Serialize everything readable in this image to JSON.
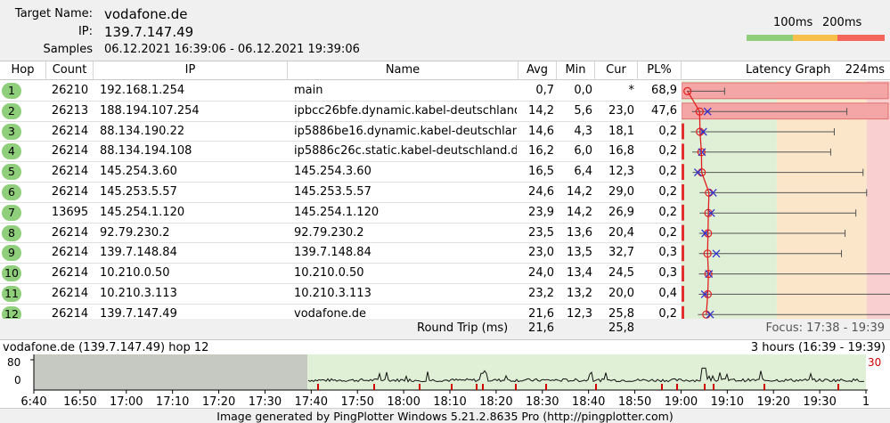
{
  "header": {
    "target_label": "Target Name:",
    "target_value": "vodafone.de",
    "ip_label": "IP:",
    "ip_value": "139.7.147.49",
    "samples_label": "Samples Timed:",
    "samples_value": "06.12.2021 16:39:06 - 06.12.2021 19:39:06"
  },
  "legend": {
    "label_100": "100ms",
    "label_200": "200ms",
    "colors": [
      "#8fce7a",
      "#f7c04a",
      "#f4665c"
    ]
  },
  "columns": {
    "hop": "Hop",
    "count": "Count",
    "ip": "IP",
    "name": "Name",
    "avg": "Avg",
    "min": "Min",
    "cur": "Cur",
    "pl": "PL%",
    "graph": "Latency Graph",
    "graph_max": "224ms"
  },
  "hops": [
    {
      "hop": "1",
      "count": "26210",
      "ip": "192.168.1.254",
      "name": "main",
      "avg": "0,7",
      "min": "0,0",
      "cur": "*",
      "pl": "68,9"
    },
    {
      "hop": "2",
      "count": "26213",
      "ip": "188.194.107.254",
      "name": "ipbcc26bfe.dynamic.kabel-deutschland.",
      "avg": "14,2",
      "min": "5,6",
      "cur": "23,0",
      "pl": "47,6"
    },
    {
      "hop": "3",
      "count": "26214",
      "ip": "88.134.190.22",
      "name": "ip5886be16.dynamic.kabel-deutschland",
      "avg": "14,6",
      "min": "4,3",
      "cur": "18,1",
      "pl": "0,2"
    },
    {
      "hop": "4",
      "count": "26214",
      "ip": "88.134.194.108",
      "name": "ip5886c26c.static.kabel-deutschland.de",
      "avg": "16,2",
      "min": "6,0",
      "cur": "16,8",
      "pl": "0,2"
    },
    {
      "hop": "5",
      "count": "26214",
      "ip": "145.254.3.60",
      "name": "145.254.3.60",
      "avg": "16,5",
      "min": "6,4",
      "cur": "12,3",
      "pl": "0,2"
    },
    {
      "hop": "6",
      "count": "26214",
      "ip": "145.253.5.57",
      "name": "145.253.5.57",
      "avg": "24,6",
      "min": "14,2",
      "cur": "29,0",
      "pl": "0,2"
    },
    {
      "hop": "7",
      "count": "13695",
      "ip": "145.254.1.120",
      "name": "145.254.1.120",
      "avg": "23,9",
      "min": "14,2",
      "cur": "26,9",
      "pl": "0,2"
    },
    {
      "hop": "8",
      "count": "26214",
      "ip": "92.79.230.2",
      "name": "92.79.230.2",
      "avg": "23,5",
      "min": "13,6",
      "cur": "20,4",
      "pl": "0,2"
    },
    {
      "hop": "9",
      "count": "26214",
      "ip": "139.7.148.84",
      "name": "139.7.148.84",
      "avg": "23,0",
      "min": "13,5",
      "cur": "32,7",
      "pl": "0,3"
    },
    {
      "hop": "10",
      "count": "26214",
      "ip": "10.210.0.50",
      "name": "10.210.0.50",
      "avg": "24,0",
      "min": "13,4",
      "cur": "24,5",
      "pl": "0,3"
    },
    {
      "hop": "11",
      "count": "26214",
      "ip": "10.210.3.113",
      "name": "10.210.3.113",
      "avg": "23,2",
      "min": "13,2",
      "cur": "20,0",
      "pl": "0,4"
    },
    {
      "hop": "12",
      "count": "26214",
      "ip": "139.7.147.49",
      "name": "vodafone.de",
      "avg": "21,6",
      "min": "12,3",
      "cur": "25,8",
      "pl": "0,2"
    }
  ],
  "roundtrip": {
    "label": "Round Trip (ms)",
    "avg": "21,6",
    "cur": "25,8",
    "focus": "Focus: 17:38 - 19:39"
  },
  "timeline": {
    "title": "vodafone.de (139.7.147.49) hop 12",
    "range": "3 hours (16:39 - 19:39)",
    "y_top": "80",
    "y_bottom": "0",
    "pl_max": "30",
    "ticks": [
      "6:40",
      "16:50",
      "17:00",
      "17:10",
      "17:20",
      "17:30",
      "17:40",
      "17:50",
      "18:00",
      "18:10",
      "18:20",
      "18:30",
      "18:40",
      "18:50",
      "19:00",
      "19:10",
      "19:20",
      "19:30",
      "1"
    ]
  },
  "footer": "Image generated by PingPlotter Windows 5.21.2.8635 Pro (http://pingplotter.com)"
}
